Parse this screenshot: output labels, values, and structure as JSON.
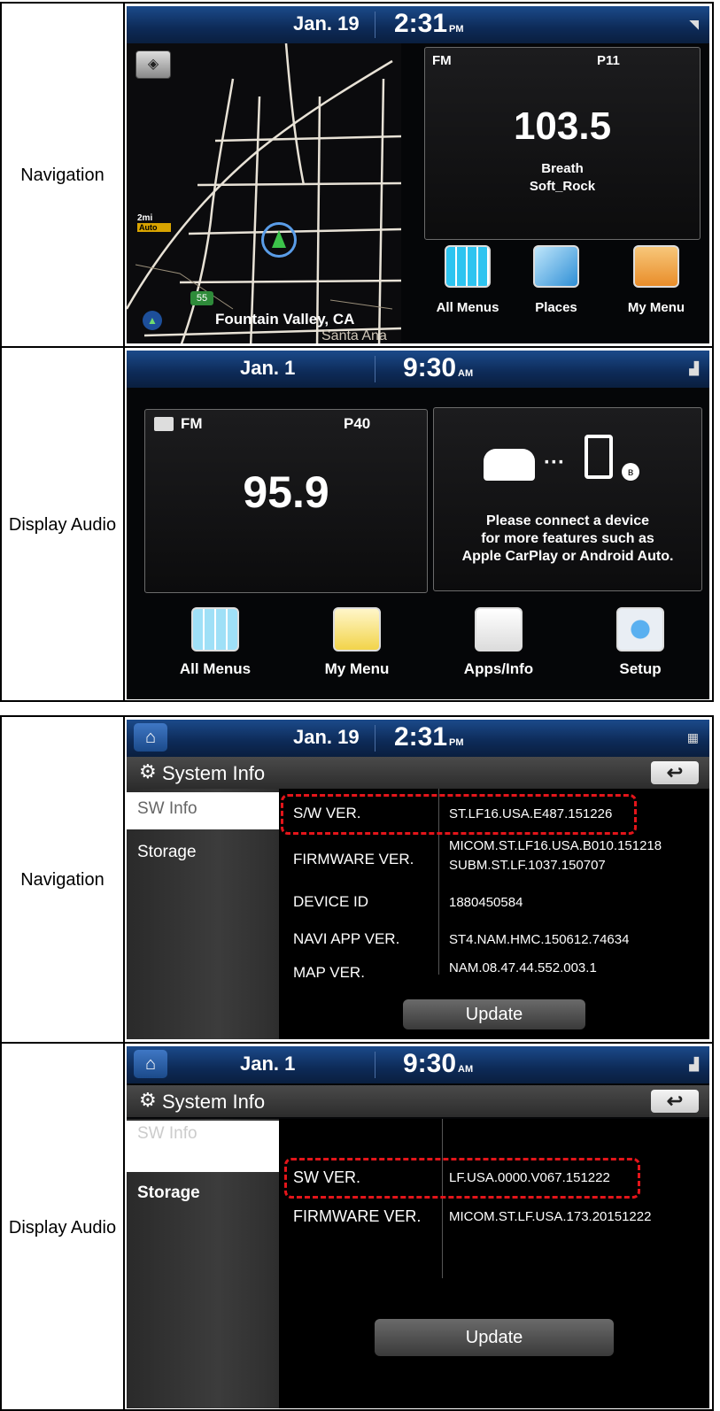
{
  "top_table": {
    "nav_label": "Navigation",
    "da_label": "Display Audio",
    "nav_home": {
      "date": "Jan. 19",
      "time": "2:31",
      "ampm": "PM",
      "map_scale": "2mi",
      "map_scale_mode": "Auto",
      "route_shield": "55",
      "location": "Fountain Valley, CA",
      "street_fragment": "Santa Ana",
      "radio_band": "FM",
      "radio_preset": "P11",
      "radio_freq": "103.5",
      "radio_line1": "Breath",
      "radio_line2": "Soft_Rock",
      "menu_all": "All Menus",
      "menu_places": "Places",
      "menu_my": "My Menu"
    },
    "da_home": {
      "date": "Jan.  1",
      "time": "9:30",
      "ampm": "AM",
      "radio_band": "FM",
      "radio_preset": "P40",
      "radio_freq": "95.9",
      "connect_line1": "Please connect a device",
      "connect_line2": "for more features such as",
      "connect_line3": "Apple CarPlay or Android Auto.",
      "menu_all": "All Menus",
      "menu_my": "My Menu",
      "menu_apps": "Apps/Info",
      "menu_setup": "Setup"
    }
  },
  "bottom_table": {
    "nav_label": "Navigation",
    "da_label": "Display Audio",
    "nav_sys": {
      "date": "Jan. 19",
      "time": "2:31",
      "ampm": "PM",
      "title": "System Info",
      "tab_sw": "SW Info",
      "tab_storage": "Storage",
      "sw_key": "S/W VER.",
      "sw_val": "ST.LF16.USA.E487.151226",
      "fw_key": "FIRMWARE VER.",
      "fw_val1": "MICOM.ST.LF16.USA.B010.151218",
      "fw_val2": "SUBM.ST.LF.1037.150707",
      "dev_key": "DEVICE ID",
      "dev_val": "1880450584",
      "navi_key": "NAVI APP VER.",
      "navi_val": "ST4.NAM.HMC.150612.74634",
      "map_key": "MAP VER.",
      "map_val": "NAM.08.47.44.552.003.1",
      "update": "Update"
    },
    "da_sys": {
      "date": "Jan.  1",
      "time": "9:30",
      "ampm": "AM",
      "title": "System Info",
      "tab_sw": "SW Info",
      "tab_storage": "Storage",
      "sw_key": "SW VER.",
      "sw_val": "LF.USA.0000.V067.151222",
      "fw_key": "FIRMWARE VER.",
      "fw_val": "MICOM.ST.LF.USA.173.20151222",
      "update": "Update"
    }
  },
  "colors": {
    "highlight": "#e3151a",
    "statusbar": "#1b4a8a"
  },
  "icons": [
    "compass-icon",
    "location-arrow-icon",
    "grid-icon",
    "search-icon",
    "folder-icon",
    "radio-icon",
    "car-icon",
    "phone-icon",
    "bluetooth-icon",
    "gear-icon",
    "home-icon",
    "back-arrow-icon",
    "signal-icon"
  ]
}
